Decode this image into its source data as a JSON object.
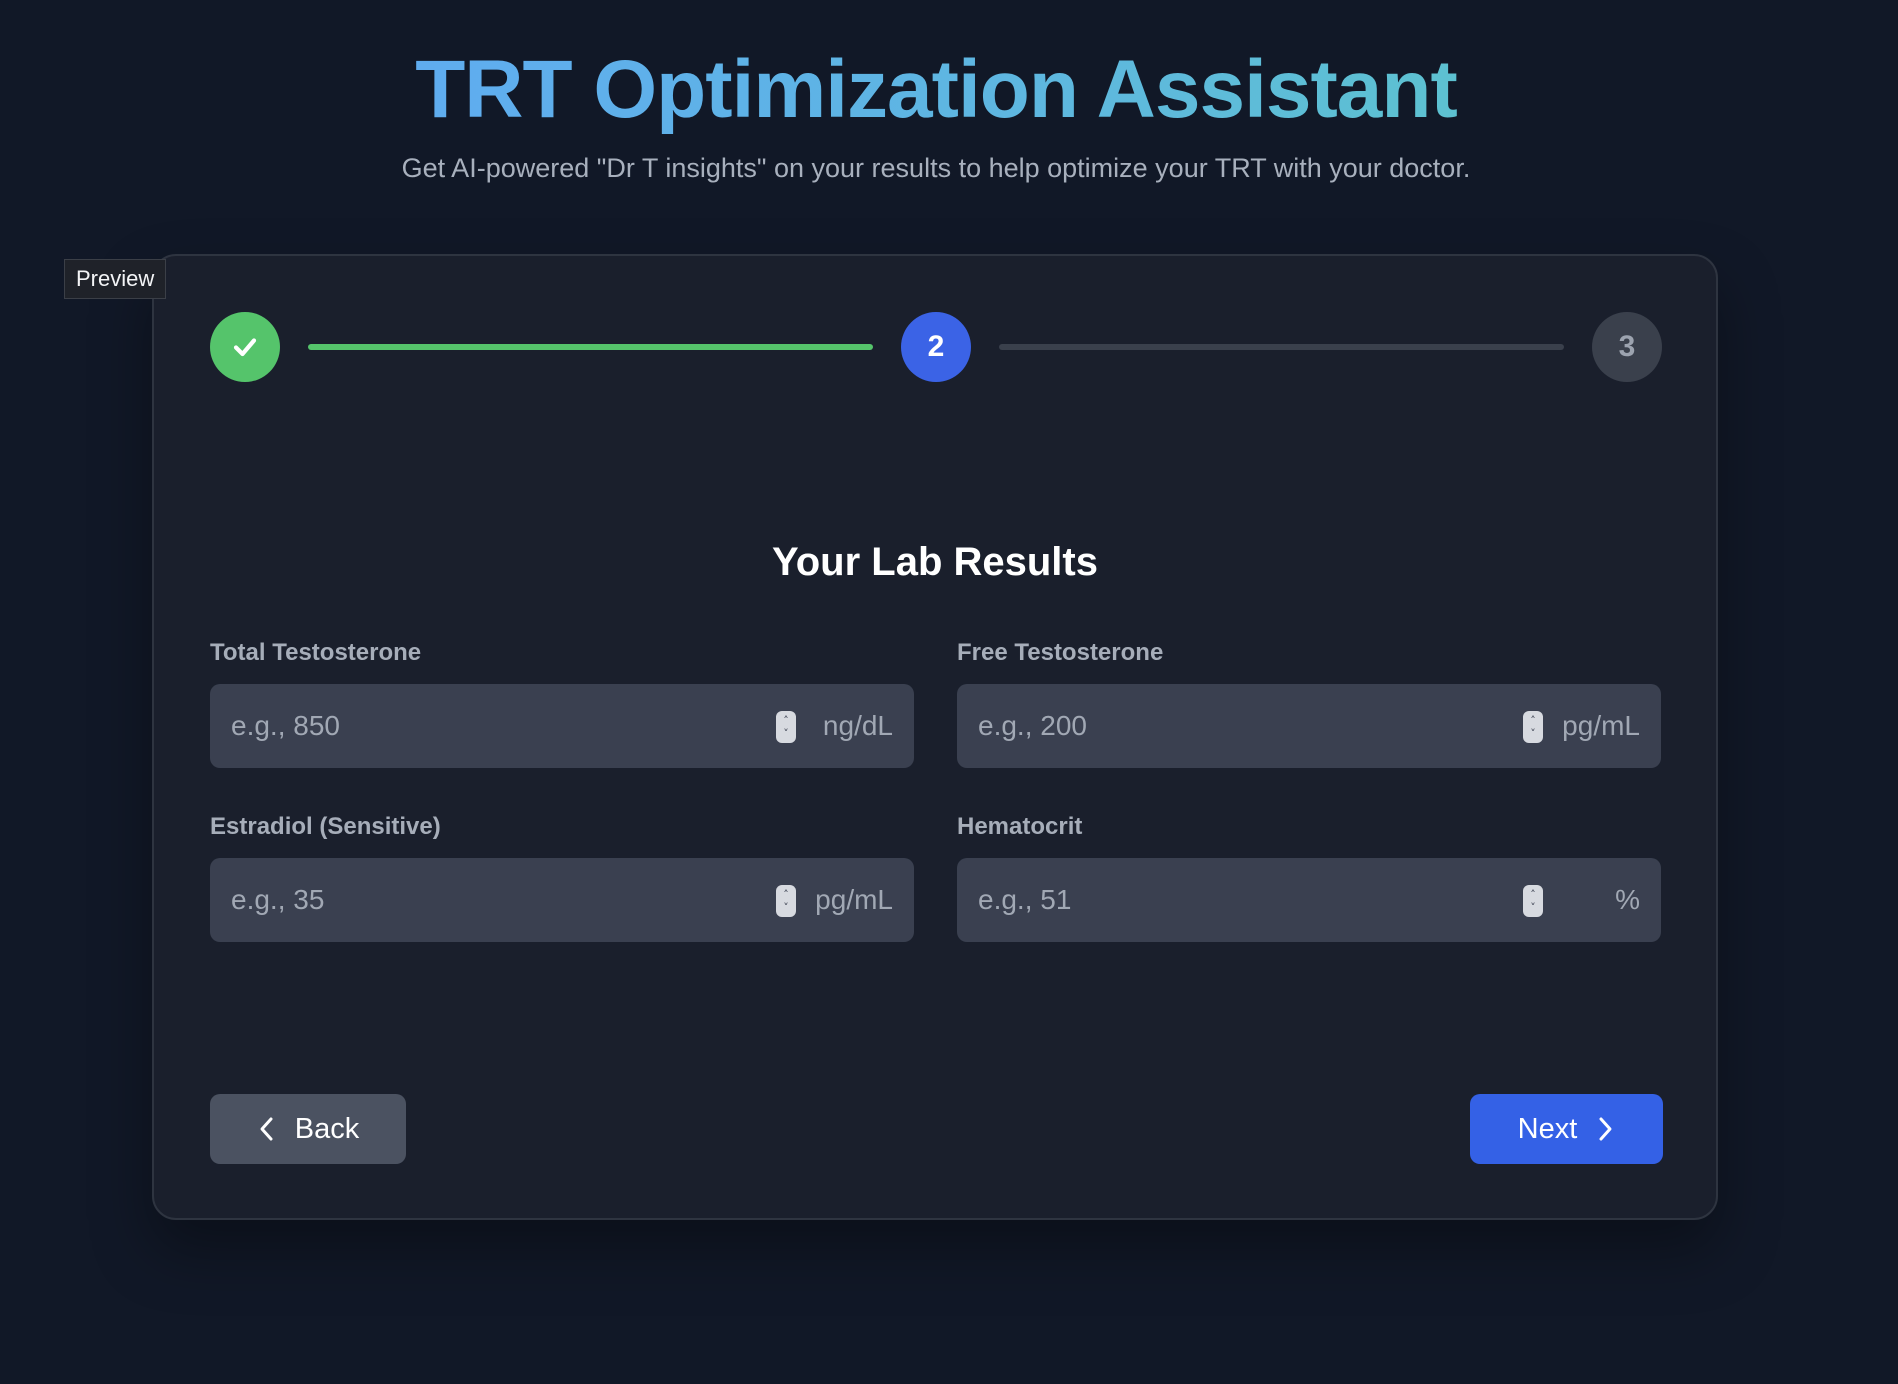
{
  "header": {
    "title": "TRT Optimization Assistant",
    "subtitle": "Get AI-powered \"Dr T insights\" on your results to help optimize your TRT with your doctor."
  },
  "preview_label": "Preview",
  "stepper": {
    "steps": [
      {
        "label": "",
        "state": "complete",
        "icon": "check-icon"
      },
      {
        "label": "2",
        "state": "active"
      },
      {
        "label": "3",
        "state": "upcoming"
      }
    ]
  },
  "section": {
    "title": "Your Lab Results"
  },
  "fields": [
    {
      "label": "Total Testosterone",
      "value": "",
      "placeholder": "e.g., 850",
      "unit": "ng/dL"
    },
    {
      "label": "Free Testosterone",
      "value": "",
      "placeholder": "e.g., 200",
      "unit": "pg/mL"
    },
    {
      "label": "Estradiol (Sensitive)",
      "value": "",
      "placeholder": "e.g., 35",
      "unit": "pg/mL"
    },
    {
      "label": "Hematocrit",
      "value": "",
      "placeholder": "e.g., 51",
      "unit": "%"
    }
  ],
  "buttons": {
    "back_label": "Back",
    "back_icon": "chevron-left-icon",
    "next_label": "Next",
    "next_icon": "chevron-right-icon"
  },
  "colors": {
    "background": "#111827",
    "card": "#1a1f2c",
    "complete": "#55c46b",
    "active": "#3b63e6",
    "upcoming": "#3a404c",
    "next_button": "#3461e6",
    "back_button": "#4b5261",
    "title_gradient_start": "#60a5fa",
    "title_gradient_end": "#5ccbc2"
  }
}
